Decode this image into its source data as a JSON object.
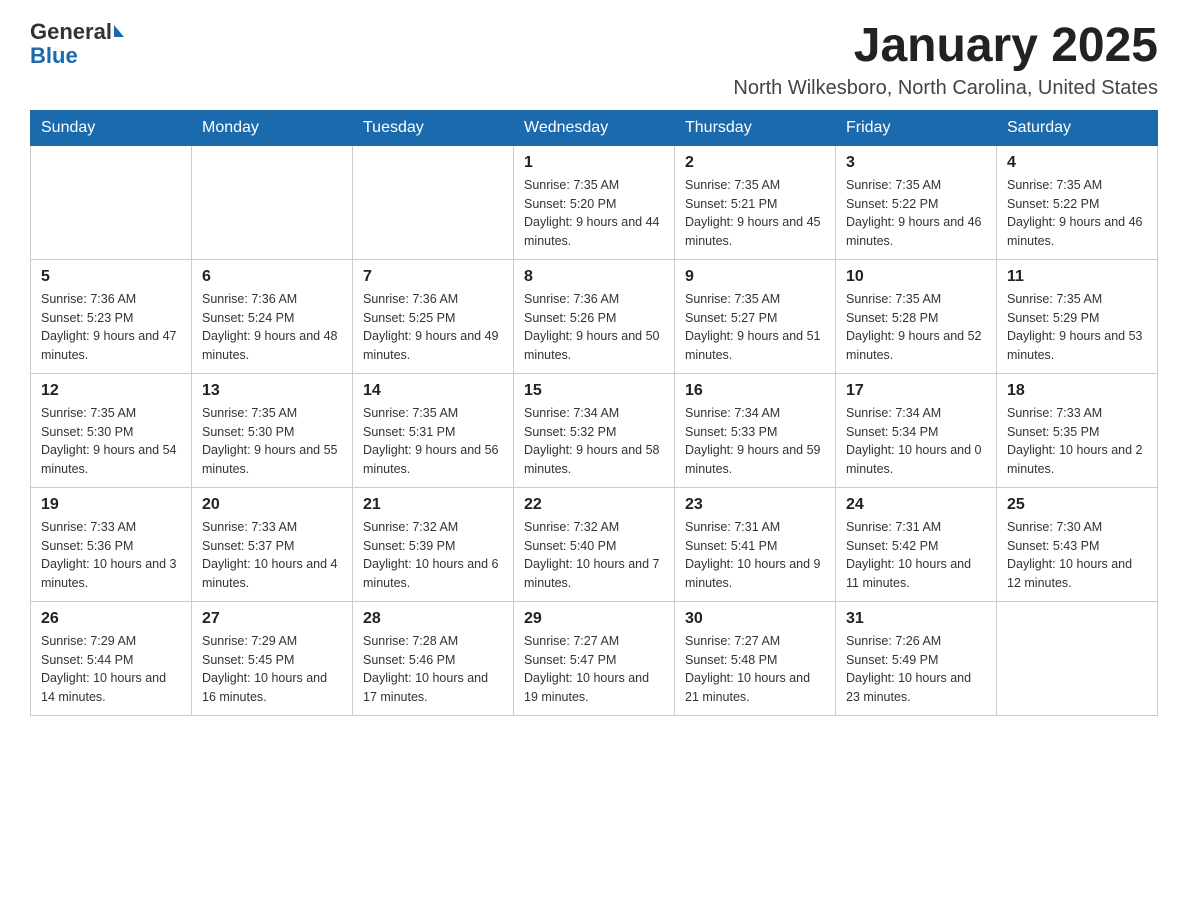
{
  "header": {
    "logo": {
      "general": "General",
      "blue": "Blue"
    },
    "title": "January 2025",
    "location": "North Wilkesboro, North Carolina, United States"
  },
  "weekdays": [
    "Sunday",
    "Monday",
    "Tuesday",
    "Wednesday",
    "Thursday",
    "Friday",
    "Saturday"
  ],
  "weeks": [
    [
      {
        "day": "",
        "info": ""
      },
      {
        "day": "",
        "info": ""
      },
      {
        "day": "",
        "info": ""
      },
      {
        "day": "1",
        "info": "Sunrise: 7:35 AM\nSunset: 5:20 PM\nDaylight: 9 hours and 44 minutes."
      },
      {
        "day": "2",
        "info": "Sunrise: 7:35 AM\nSunset: 5:21 PM\nDaylight: 9 hours and 45 minutes."
      },
      {
        "day": "3",
        "info": "Sunrise: 7:35 AM\nSunset: 5:22 PM\nDaylight: 9 hours and 46 minutes."
      },
      {
        "day": "4",
        "info": "Sunrise: 7:35 AM\nSunset: 5:22 PM\nDaylight: 9 hours and 46 minutes."
      }
    ],
    [
      {
        "day": "5",
        "info": "Sunrise: 7:36 AM\nSunset: 5:23 PM\nDaylight: 9 hours and 47 minutes."
      },
      {
        "day": "6",
        "info": "Sunrise: 7:36 AM\nSunset: 5:24 PM\nDaylight: 9 hours and 48 minutes."
      },
      {
        "day": "7",
        "info": "Sunrise: 7:36 AM\nSunset: 5:25 PM\nDaylight: 9 hours and 49 minutes."
      },
      {
        "day": "8",
        "info": "Sunrise: 7:36 AM\nSunset: 5:26 PM\nDaylight: 9 hours and 50 minutes."
      },
      {
        "day": "9",
        "info": "Sunrise: 7:35 AM\nSunset: 5:27 PM\nDaylight: 9 hours and 51 minutes."
      },
      {
        "day": "10",
        "info": "Sunrise: 7:35 AM\nSunset: 5:28 PM\nDaylight: 9 hours and 52 minutes."
      },
      {
        "day": "11",
        "info": "Sunrise: 7:35 AM\nSunset: 5:29 PM\nDaylight: 9 hours and 53 minutes."
      }
    ],
    [
      {
        "day": "12",
        "info": "Sunrise: 7:35 AM\nSunset: 5:30 PM\nDaylight: 9 hours and 54 minutes."
      },
      {
        "day": "13",
        "info": "Sunrise: 7:35 AM\nSunset: 5:30 PM\nDaylight: 9 hours and 55 minutes."
      },
      {
        "day": "14",
        "info": "Sunrise: 7:35 AM\nSunset: 5:31 PM\nDaylight: 9 hours and 56 minutes."
      },
      {
        "day": "15",
        "info": "Sunrise: 7:34 AM\nSunset: 5:32 PM\nDaylight: 9 hours and 58 minutes."
      },
      {
        "day": "16",
        "info": "Sunrise: 7:34 AM\nSunset: 5:33 PM\nDaylight: 9 hours and 59 minutes."
      },
      {
        "day": "17",
        "info": "Sunrise: 7:34 AM\nSunset: 5:34 PM\nDaylight: 10 hours and 0 minutes."
      },
      {
        "day": "18",
        "info": "Sunrise: 7:33 AM\nSunset: 5:35 PM\nDaylight: 10 hours and 2 minutes."
      }
    ],
    [
      {
        "day": "19",
        "info": "Sunrise: 7:33 AM\nSunset: 5:36 PM\nDaylight: 10 hours and 3 minutes."
      },
      {
        "day": "20",
        "info": "Sunrise: 7:33 AM\nSunset: 5:37 PM\nDaylight: 10 hours and 4 minutes."
      },
      {
        "day": "21",
        "info": "Sunrise: 7:32 AM\nSunset: 5:39 PM\nDaylight: 10 hours and 6 minutes."
      },
      {
        "day": "22",
        "info": "Sunrise: 7:32 AM\nSunset: 5:40 PM\nDaylight: 10 hours and 7 minutes."
      },
      {
        "day": "23",
        "info": "Sunrise: 7:31 AM\nSunset: 5:41 PM\nDaylight: 10 hours and 9 minutes."
      },
      {
        "day": "24",
        "info": "Sunrise: 7:31 AM\nSunset: 5:42 PM\nDaylight: 10 hours and 11 minutes."
      },
      {
        "day": "25",
        "info": "Sunrise: 7:30 AM\nSunset: 5:43 PM\nDaylight: 10 hours and 12 minutes."
      }
    ],
    [
      {
        "day": "26",
        "info": "Sunrise: 7:29 AM\nSunset: 5:44 PM\nDaylight: 10 hours and 14 minutes."
      },
      {
        "day": "27",
        "info": "Sunrise: 7:29 AM\nSunset: 5:45 PM\nDaylight: 10 hours and 16 minutes."
      },
      {
        "day": "28",
        "info": "Sunrise: 7:28 AM\nSunset: 5:46 PM\nDaylight: 10 hours and 17 minutes."
      },
      {
        "day": "29",
        "info": "Sunrise: 7:27 AM\nSunset: 5:47 PM\nDaylight: 10 hours and 19 minutes."
      },
      {
        "day": "30",
        "info": "Sunrise: 7:27 AM\nSunset: 5:48 PM\nDaylight: 10 hours and 21 minutes."
      },
      {
        "day": "31",
        "info": "Sunrise: 7:26 AM\nSunset: 5:49 PM\nDaylight: 10 hours and 23 minutes."
      },
      {
        "day": "",
        "info": ""
      }
    ]
  ]
}
